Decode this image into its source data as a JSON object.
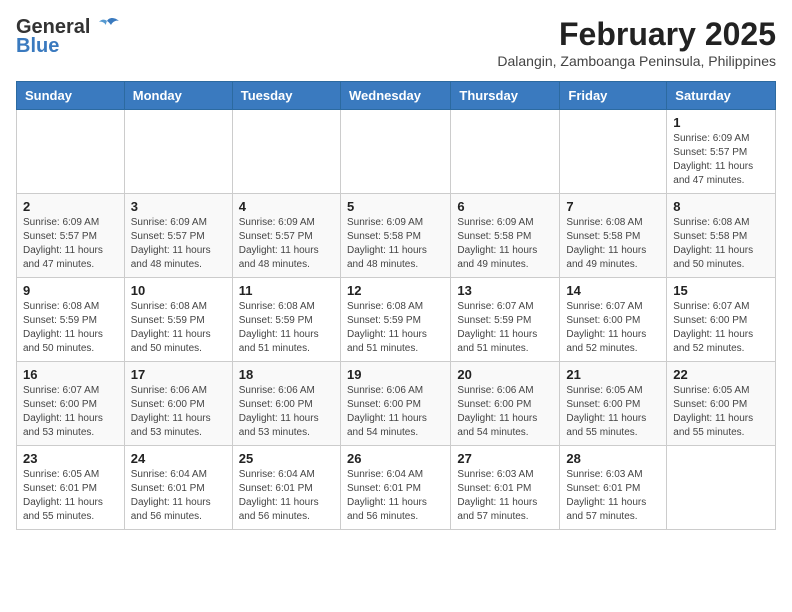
{
  "logo": {
    "line1": "General",
    "line2": "Blue"
  },
  "title": "February 2025",
  "subtitle": "Dalangin, Zamboanga Peninsula, Philippines",
  "weekdays": [
    "Sunday",
    "Monday",
    "Tuesday",
    "Wednesday",
    "Thursday",
    "Friday",
    "Saturday"
  ],
  "weeks": [
    [
      {
        "day": "",
        "info": ""
      },
      {
        "day": "",
        "info": ""
      },
      {
        "day": "",
        "info": ""
      },
      {
        "day": "",
        "info": ""
      },
      {
        "day": "",
        "info": ""
      },
      {
        "day": "",
        "info": ""
      },
      {
        "day": "1",
        "info": "Sunrise: 6:09 AM\nSunset: 5:57 PM\nDaylight: 11 hours and 47 minutes."
      }
    ],
    [
      {
        "day": "2",
        "info": "Sunrise: 6:09 AM\nSunset: 5:57 PM\nDaylight: 11 hours and 47 minutes."
      },
      {
        "day": "3",
        "info": "Sunrise: 6:09 AM\nSunset: 5:57 PM\nDaylight: 11 hours and 48 minutes."
      },
      {
        "day": "4",
        "info": "Sunrise: 6:09 AM\nSunset: 5:57 PM\nDaylight: 11 hours and 48 minutes."
      },
      {
        "day": "5",
        "info": "Sunrise: 6:09 AM\nSunset: 5:58 PM\nDaylight: 11 hours and 48 minutes."
      },
      {
        "day": "6",
        "info": "Sunrise: 6:09 AM\nSunset: 5:58 PM\nDaylight: 11 hours and 49 minutes."
      },
      {
        "day": "7",
        "info": "Sunrise: 6:08 AM\nSunset: 5:58 PM\nDaylight: 11 hours and 49 minutes."
      },
      {
        "day": "8",
        "info": "Sunrise: 6:08 AM\nSunset: 5:58 PM\nDaylight: 11 hours and 50 minutes."
      }
    ],
    [
      {
        "day": "9",
        "info": "Sunrise: 6:08 AM\nSunset: 5:59 PM\nDaylight: 11 hours and 50 minutes."
      },
      {
        "day": "10",
        "info": "Sunrise: 6:08 AM\nSunset: 5:59 PM\nDaylight: 11 hours and 50 minutes."
      },
      {
        "day": "11",
        "info": "Sunrise: 6:08 AM\nSunset: 5:59 PM\nDaylight: 11 hours and 51 minutes."
      },
      {
        "day": "12",
        "info": "Sunrise: 6:08 AM\nSunset: 5:59 PM\nDaylight: 11 hours and 51 minutes."
      },
      {
        "day": "13",
        "info": "Sunrise: 6:07 AM\nSunset: 5:59 PM\nDaylight: 11 hours and 51 minutes."
      },
      {
        "day": "14",
        "info": "Sunrise: 6:07 AM\nSunset: 6:00 PM\nDaylight: 11 hours and 52 minutes."
      },
      {
        "day": "15",
        "info": "Sunrise: 6:07 AM\nSunset: 6:00 PM\nDaylight: 11 hours and 52 minutes."
      }
    ],
    [
      {
        "day": "16",
        "info": "Sunrise: 6:07 AM\nSunset: 6:00 PM\nDaylight: 11 hours and 53 minutes."
      },
      {
        "day": "17",
        "info": "Sunrise: 6:06 AM\nSunset: 6:00 PM\nDaylight: 11 hours and 53 minutes."
      },
      {
        "day": "18",
        "info": "Sunrise: 6:06 AM\nSunset: 6:00 PM\nDaylight: 11 hours and 53 minutes."
      },
      {
        "day": "19",
        "info": "Sunrise: 6:06 AM\nSunset: 6:00 PM\nDaylight: 11 hours and 54 minutes."
      },
      {
        "day": "20",
        "info": "Sunrise: 6:06 AM\nSunset: 6:00 PM\nDaylight: 11 hours and 54 minutes."
      },
      {
        "day": "21",
        "info": "Sunrise: 6:05 AM\nSunset: 6:00 PM\nDaylight: 11 hours and 55 minutes."
      },
      {
        "day": "22",
        "info": "Sunrise: 6:05 AM\nSunset: 6:00 PM\nDaylight: 11 hours and 55 minutes."
      }
    ],
    [
      {
        "day": "23",
        "info": "Sunrise: 6:05 AM\nSunset: 6:01 PM\nDaylight: 11 hours and 55 minutes."
      },
      {
        "day": "24",
        "info": "Sunrise: 6:04 AM\nSunset: 6:01 PM\nDaylight: 11 hours and 56 minutes."
      },
      {
        "day": "25",
        "info": "Sunrise: 6:04 AM\nSunset: 6:01 PM\nDaylight: 11 hours and 56 minutes."
      },
      {
        "day": "26",
        "info": "Sunrise: 6:04 AM\nSunset: 6:01 PM\nDaylight: 11 hours and 56 minutes."
      },
      {
        "day": "27",
        "info": "Sunrise: 6:03 AM\nSunset: 6:01 PM\nDaylight: 11 hours and 57 minutes."
      },
      {
        "day": "28",
        "info": "Sunrise: 6:03 AM\nSunset: 6:01 PM\nDaylight: 11 hours and 57 minutes."
      },
      {
        "day": "",
        "info": ""
      }
    ]
  ]
}
